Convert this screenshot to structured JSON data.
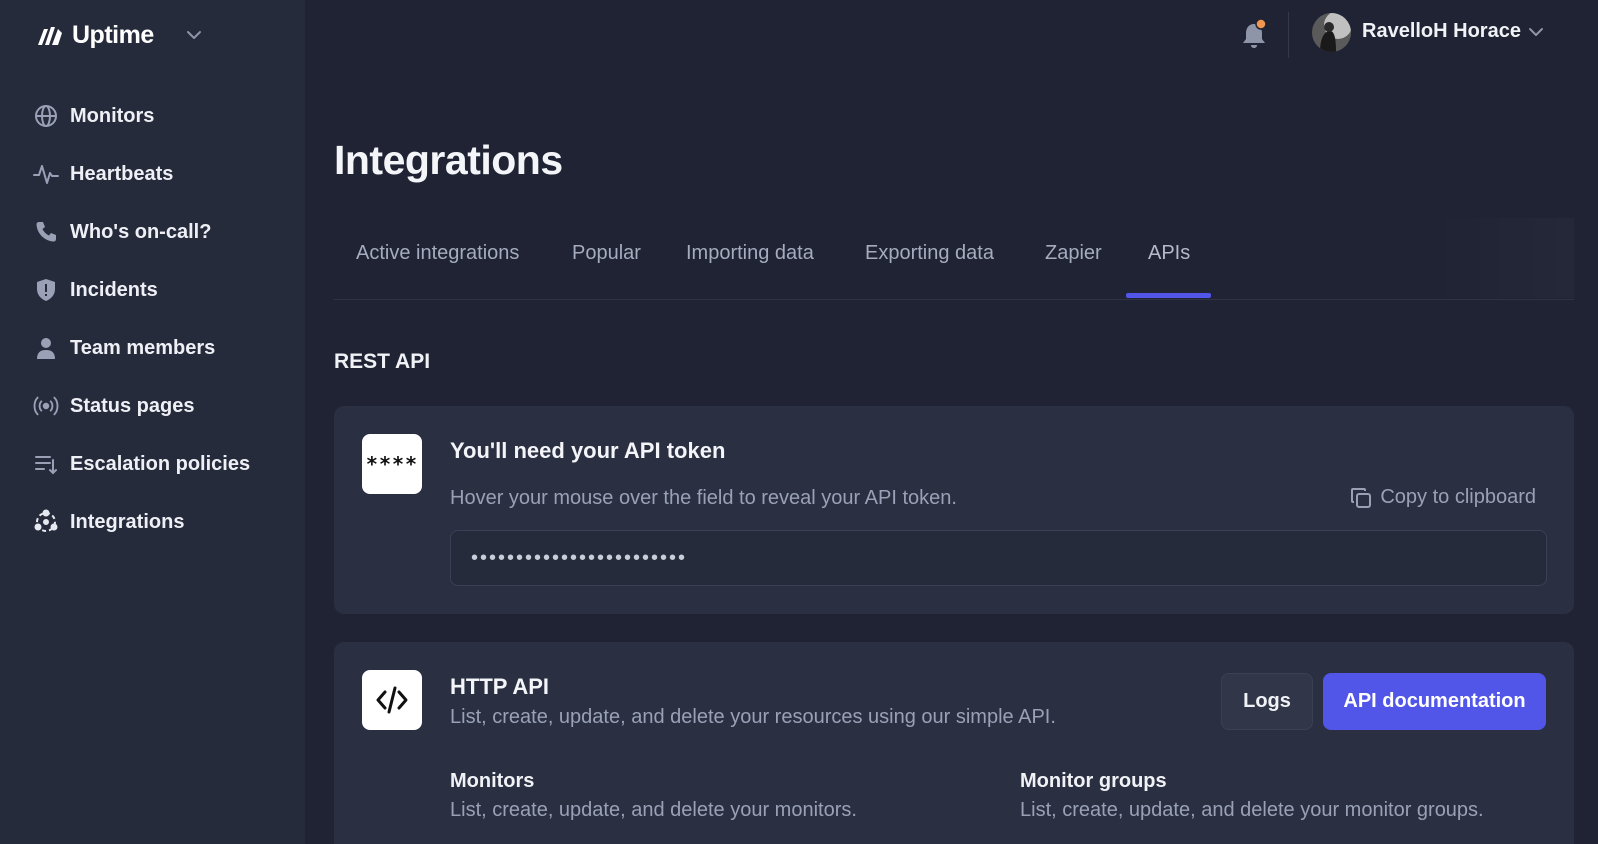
{
  "brand": {
    "name": "Uptime"
  },
  "sidebar": {
    "items": [
      {
        "label": "Monitors",
        "icon": "globe-icon"
      },
      {
        "label": "Heartbeats",
        "icon": "pulse-icon"
      },
      {
        "label": "Who's on-call?",
        "icon": "phone-icon"
      },
      {
        "label": "Incidents",
        "icon": "shield-icon"
      },
      {
        "label": "Team members",
        "icon": "user-icon"
      },
      {
        "label": "Status pages",
        "icon": "broadcast-icon"
      },
      {
        "label": "Escalation policies",
        "icon": "list-sort-icon"
      },
      {
        "label": "Integrations",
        "icon": "integrations-icon"
      }
    ]
  },
  "topbar": {
    "user_name": "RavelloH Horace",
    "notification_dot_color": "#f0964f"
  },
  "page": {
    "title": "Integrations",
    "tabs": [
      {
        "label": "Active integrations"
      },
      {
        "label": "Popular"
      },
      {
        "label": "Importing data"
      },
      {
        "label": "Exporting data"
      },
      {
        "label": "Zapier"
      },
      {
        "label": "APIs",
        "active": true
      }
    ],
    "section_title": "REST API"
  },
  "token_card": {
    "icon_text": "****",
    "heading": "You'll need your API token",
    "description": "Hover your mouse over the field to reveal your API token.",
    "copy_label": "Copy to clipboard",
    "token_masked": "••••••••••••••••••••••••"
  },
  "http_card": {
    "icon_text": "</>",
    "heading": "HTTP API",
    "description": "List, create, update, and delete your resources using our simple API.",
    "logs_label": "Logs",
    "docs_label": "API documentation",
    "items": [
      {
        "title": "Monitors",
        "description": "List, create, update, and delete your monitors."
      },
      {
        "title": "Monitor groups",
        "description": "List, create, update, and delete your monitor groups."
      }
    ]
  },
  "colors": {
    "accent": "#5155e8",
    "background": "#1f2333",
    "sidebar": "#262b3c",
    "card": "#2a3042"
  }
}
